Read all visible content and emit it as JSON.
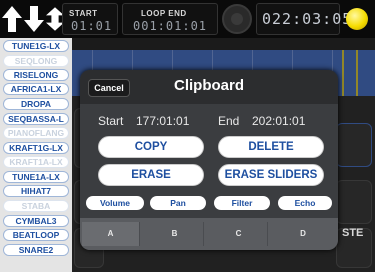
{
  "topbar": {
    "start_label": "START",
    "start_value": "01:01",
    "loop_end_label": "LOOP END",
    "loop_end_value": "001:01:01",
    "time_value": "022:03:05"
  },
  "tracks": [
    {
      "label": "TUNE1G-LX",
      "dim": false
    },
    {
      "label": "SEQLONG",
      "dim": true
    },
    {
      "label": "RISELONG",
      "dim": false
    },
    {
      "label": "AFRICA1-LX",
      "dim": false
    },
    {
      "label": "DROPA",
      "dim": false
    },
    {
      "label": "SEQBASSA-L",
      "dim": false
    },
    {
      "label": "PIANOFLANG",
      "dim": true
    },
    {
      "label": "KRAFT1G-LX",
      "dim": false
    },
    {
      "label": "KRAFT1A-LX",
      "dim": true
    },
    {
      "label": "TUNE1A-LX",
      "dim": false
    },
    {
      "label": "HIHAT7",
      "dim": false
    },
    {
      "label": "STABA",
      "dim": true
    },
    {
      "label": "CYMBAL3",
      "dim": false
    },
    {
      "label": "BEATLOOP",
      "dim": false
    },
    {
      "label": "SNARE2",
      "dim": false
    }
  ],
  "clipboard": {
    "title": "Clipboard",
    "cancel_label": "Cancel",
    "start_label": "Start",
    "start_value": "177:01:01",
    "end_label": "End",
    "end_value": "202:01:01",
    "copy_label": "COPY",
    "delete_label": "DELETE",
    "erase_label": "ERASE",
    "erase_sliders_label": "ERASE SLIDERS",
    "volume_label": "Volume",
    "pan_label": "Pan",
    "filter_label": "Filter",
    "echo_label": "Echo",
    "tab_a": "A",
    "tab_b": "B",
    "tab_c": "C",
    "tab_d": "D"
  },
  "background_label": "STE"
}
